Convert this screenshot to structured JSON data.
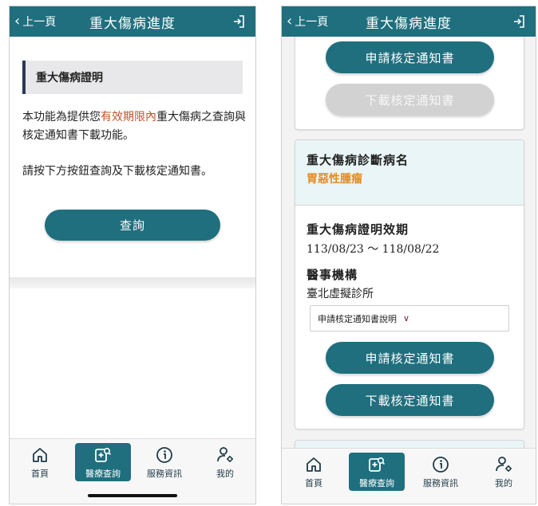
{
  "header": {
    "back_label": "上一頁",
    "title": "重大傷病進度"
  },
  "left": {
    "section_title": "重大傷病證明",
    "intro_prefix": "本功能為提供您",
    "intro_highlight": "有效期限內",
    "intro_suffix": "重大傷病之查詢與核定通知書下載功能。",
    "instruction": "請按下方按鈕查詢及下載核定通知書。",
    "query_button": "查詢"
  },
  "right": {
    "apply_button": "申請核定通知書",
    "download_button": "下載核定通知書",
    "diagnosis_label": "重大傷病診斷病名",
    "diagnosis_value": "胃惡性腫瘤",
    "validity_label": "重大傷病證明效期",
    "validity_value": "113/08/23 ～ 118/08/22",
    "institution_label": "醫事機構",
    "institution_value": "臺北虛擬診所",
    "dropdown_label": "申請核定通知書說明"
  },
  "tabbar": {
    "items": [
      {
        "label": "首頁",
        "icon": "home-icon"
      },
      {
        "label": "醫療查詢",
        "icon": "medical-search-icon"
      },
      {
        "label": "服務資訊",
        "icon": "info-icon"
      },
      {
        "label": "我的",
        "icon": "user-settings-icon"
      }
    ],
    "active_index": 1
  },
  "colors": {
    "primary": "#1f6f7e",
    "highlight": "#c0542c",
    "orange": "#e58a1e",
    "disabled": "#d2d2d2"
  }
}
